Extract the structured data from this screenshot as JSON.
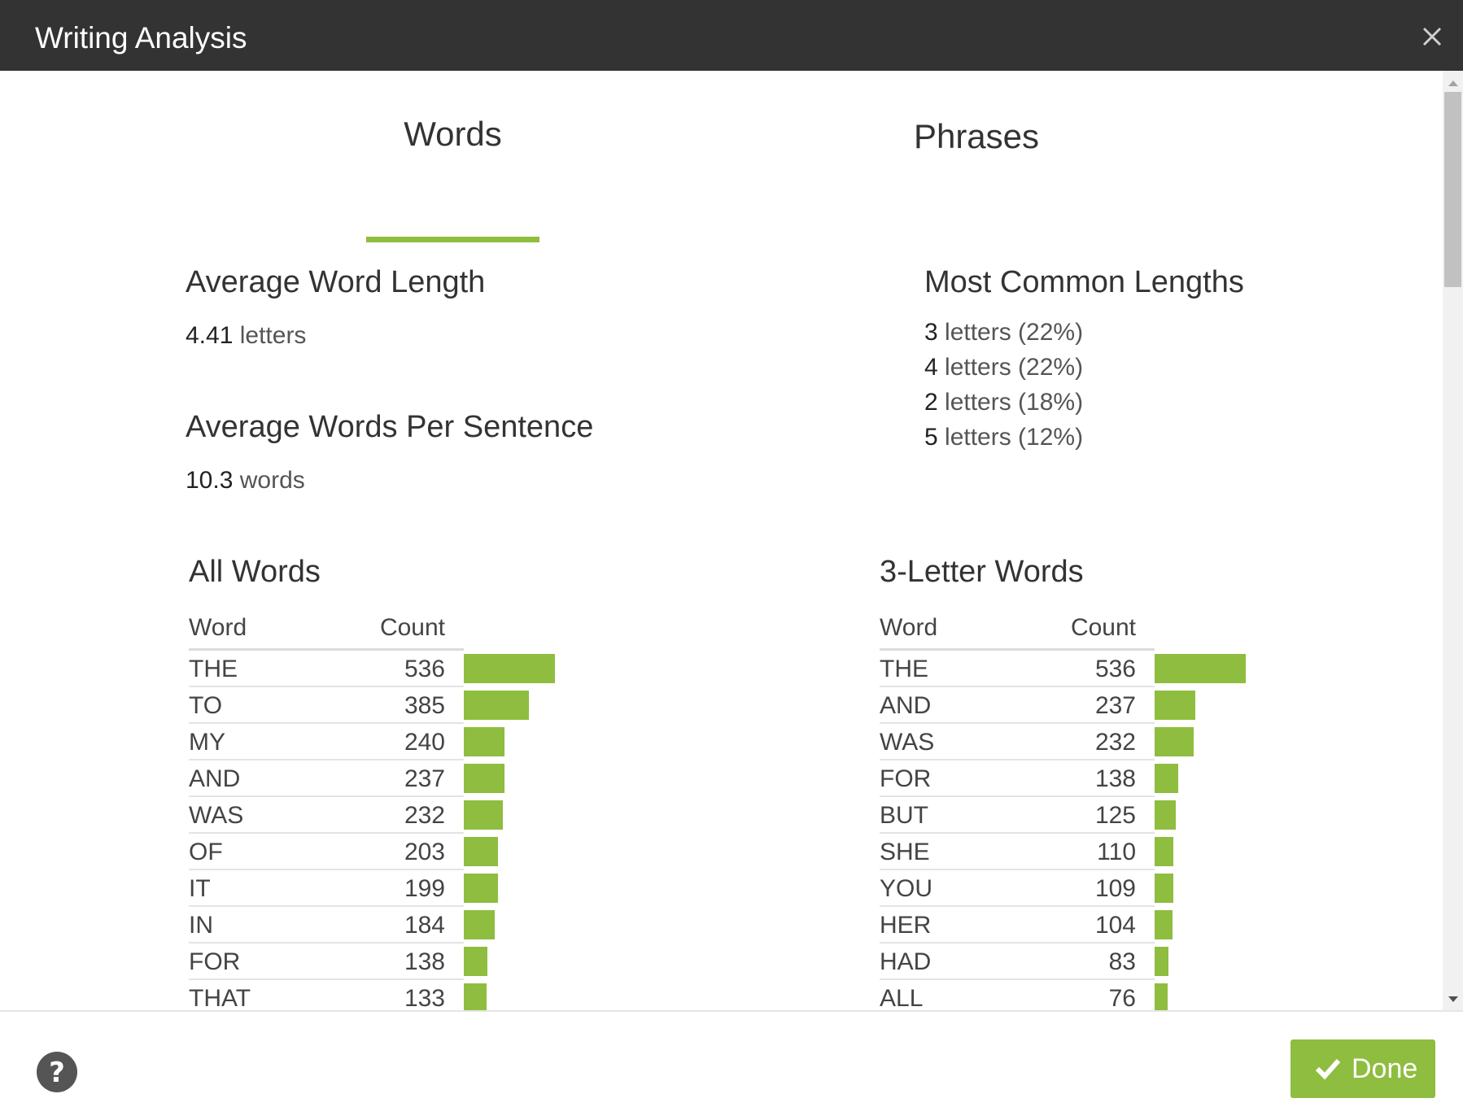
{
  "window": {
    "title": "Writing Analysis",
    "close_icon": "close-icon"
  },
  "tabs": [
    {
      "label": "Words",
      "active": true
    },
    {
      "label": "Phrases",
      "active": false
    }
  ],
  "average_word_length": {
    "title": "Average Word Length",
    "value": "4.41",
    "unit": "letters"
  },
  "average_words_per_sentence": {
    "title": "Average Words Per Sentence",
    "value": "10.3",
    "unit": "words"
  },
  "most_common_lengths": {
    "title": "Most Common Lengths",
    "items": [
      {
        "value": "3",
        "text": "letters (22%)"
      },
      {
        "value": "4",
        "text": "letters (22%)"
      },
      {
        "value": "2",
        "text": "letters (18%)"
      },
      {
        "value": "5",
        "text": "letters (12%)"
      }
    ]
  },
  "all_words": {
    "title": "All Words",
    "columns": [
      "Word",
      "Count"
    ],
    "rows": [
      {
        "word": "THE",
        "count": 536
      },
      {
        "word": "TO",
        "count": 385
      },
      {
        "word": "MY",
        "count": 240
      },
      {
        "word": "AND",
        "count": 237
      },
      {
        "word": "WAS",
        "count": 232
      },
      {
        "word": "OF",
        "count": 203
      },
      {
        "word": "IT",
        "count": 199
      },
      {
        "word": "IN",
        "count": 184
      },
      {
        "word": "FOR",
        "count": 138
      },
      {
        "word": "THAT",
        "count": 133
      }
    ]
  },
  "three_letter_words": {
    "title": "3-Letter Words",
    "columns": [
      "Word",
      "Count"
    ],
    "rows": [
      {
        "word": "THE",
        "count": 536
      },
      {
        "word": "AND",
        "count": 237
      },
      {
        "word": "WAS",
        "count": 232
      },
      {
        "word": "FOR",
        "count": 138
      },
      {
        "word": "BUT",
        "count": 125
      },
      {
        "word": "SHE",
        "count": 110
      },
      {
        "word": "YOU",
        "count": 109
      },
      {
        "word": "HER",
        "count": 104
      },
      {
        "word": "HAD",
        "count": 83
      },
      {
        "word": "ALL",
        "count": 76
      }
    ]
  },
  "footer": {
    "help_icon": "help-icon",
    "done_label": "Done",
    "done_icon": "check-icon"
  },
  "colors": {
    "accent": "#8fbd3f",
    "titlebar": "#333333"
  }
}
